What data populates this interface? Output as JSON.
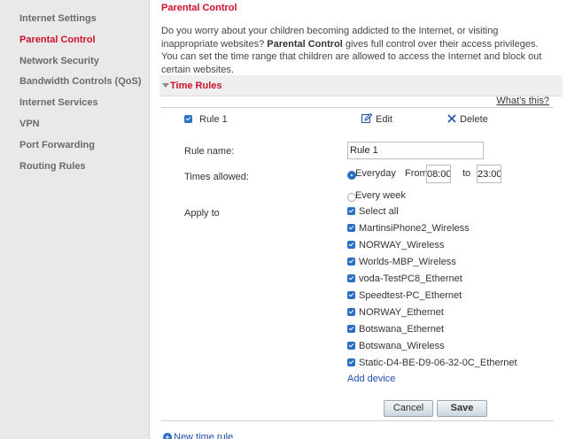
{
  "sidebar": {
    "items": [
      {
        "label": "Internet Settings",
        "active": false
      },
      {
        "label": "Parental Control",
        "active": true
      },
      {
        "label": "Network Security",
        "active": false
      },
      {
        "label": "Bandwidth Controls (QoS)",
        "active": false
      },
      {
        "label": "Internet Services",
        "active": false
      },
      {
        "label": "VPN",
        "active": false
      },
      {
        "label": "Port Forwarding",
        "active": false
      },
      {
        "label": "Routing Rules",
        "active": false
      }
    ]
  },
  "page": {
    "title": "Parental Control",
    "intro_lead": "Do you worry about your children becoming addicted to the Internet, or visiting inappropriate websites?",
    "intro_bold": "Parental Control",
    "intro_rest": " gives full control over their access privileges. You can set the time range that children are allowed to access the Internet and block out certain websites."
  },
  "section": {
    "title": "Time Rules",
    "whats_this": "What's this?"
  },
  "rule": {
    "name_header": "Rule 1",
    "edit_label": "Edit",
    "delete_label": "Delete",
    "rule_name_label": "Rule name:",
    "rule_name_value": "Rule 1",
    "times_allowed_label": "Times allowed:",
    "everyday_label": "Everyday",
    "from_label": "From",
    "from_value": "08:00",
    "to_label": "to",
    "to_value": "23:00",
    "everyweek_label": "Every week",
    "schedule_selected": "Everyday",
    "apply_to_label": "Apply to",
    "devices": [
      {
        "label": "Select all",
        "checked": true
      },
      {
        "label": "MartinsiPhone2_Wireless",
        "checked": true
      },
      {
        "label": "NORWAY_Wireless",
        "checked": true
      },
      {
        "label": "Worlds-MBP_Wireless",
        "checked": true
      },
      {
        "label": "voda-TestPC8_Ethernet",
        "checked": true
      },
      {
        "label": "Speedtest-PC_Ethernet",
        "checked": true
      },
      {
        "label": "NORWAY_Ethernet",
        "checked": true
      },
      {
        "label": "Botswana_Ethernet",
        "checked": true
      },
      {
        "label": "Botswana_Wireless",
        "checked": true
      },
      {
        "label": "Static-D4-BE-D9-06-32-0C_Ethernet",
        "checked": true
      }
    ],
    "add_device": "Add device",
    "cancel_label": "Cancel",
    "save_label": "Save"
  },
  "footer": {
    "new_rule": "New time rule"
  },
  "colors": {
    "accent": "#d0102a",
    "link": "#1d4fa8",
    "checkbox": "#2a6fc2",
    "sidebar_bg": "#e9e9e9"
  }
}
